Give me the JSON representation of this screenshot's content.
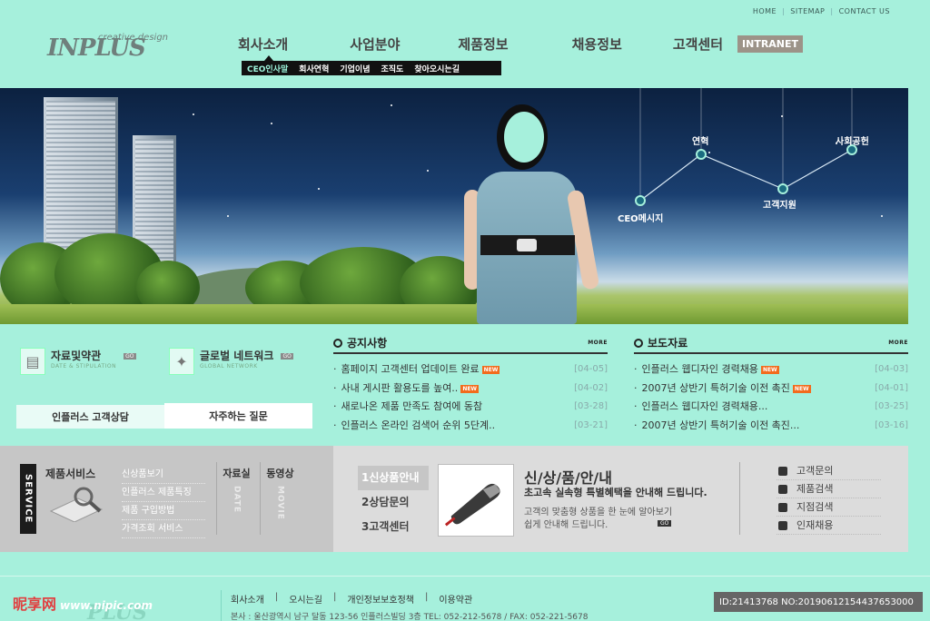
{
  "toplinks": [
    "HOME",
    "SITEMAP",
    "CONTACT US"
  ],
  "logo": {
    "brand": "INPLUS",
    "tagline": "creative design"
  },
  "nav": {
    "items": [
      "회사소개",
      "사업분야",
      "제품정보",
      "채용정보",
      "고객센터"
    ],
    "intranet": "INTRANET",
    "sub": [
      "CEO인사말",
      "회사연혁",
      "기업이념",
      "조직도",
      "찾아오시는길"
    ]
  },
  "banner": {
    "nodes": [
      "CEO메시지",
      "연혁",
      "고객지원",
      "사회공헌"
    ]
  },
  "quick": {
    "items": [
      {
        "title": "자료및약관",
        "sub": "DATE & STIPULATION",
        "icon": "document-icon"
      },
      {
        "title": "글로벌 네트워크",
        "sub": "GLOBAL NETWORK",
        "icon": "globe-icon"
      }
    ],
    "go": "GO",
    "consult_tabs": [
      "인플러스 고객상담",
      "자주하는 질문"
    ]
  },
  "notice": {
    "title": "공지사항",
    "more": "MORE",
    "items": [
      {
        "text": "홈페이지 고객센터 업데이트 완료",
        "new": true,
        "date": "[04-05]"
      },
      {
        "text": "사내 게시판 활용도를 높여..",
        "new": true,
        "date": "[04-02]"
      },
      {
        "text": "새로나온 제품 만족도 참여에 동참",
        "new": false,
        "date": "[03-28]"
      },
      {
        "text": "인플러스 온라인 검색어 순위 5단계..",
        "new": false,
        "date": "[03-21]"
      }
    ]
  },
  "press": {
    "title": "보도자료",
    "more": "MORE",
    "items": [
      {
        "text": "인플러스 웹디자인 경력채용",
        "new": true,
        "date": "[04-03]"
      },
      {
        "text": "2007년 상반기 특허기술 이전 촉진",
        "new": true,
        "date": "[04-01]"
      },
      {
        "text": "인플러스 웹디자인 경력채용...",
        "new": false,
        "date": "[03-25]"
      },
      {
        "text": "2007년 상반기 특허기술 이전 촉진...",
        "new": false,
        "date": "[03-16]"
      }
    ]
  },
  "new_label": "NEW",
  "service": {
    "tag": "SERVICE",
    "title": "제품서비스",
    "list": [
      "신상품보기",
      "인플러스 제품특징",
      "제품 구입방법",
      "가격조회 서비스"
    ],
    "col1": {
      "head": "자료실",
      "vertical": "DATE"
    },
    "col2": {
      "head": "동영상",
      "vertical": "MOVIE"
    },
    "tabs": [
      "1신상품안내",
      "2상담문의",
      "3고객센터"
    ],
    "product_title": "신/상/품/안/내",
    "product_sub": "초고속 실속형 특별혜택을 안내해 드립니다.",
    "product_desc": "고객의 맞춤형 상품을 한 눈에 알아보기 쉽게 안내해 드립니다.",
    "product_go": "GO",
    "links": [
      "고객문의",
      "제품검색",
      "지점검색",
      "인재채용"
    ]
  },
  "footer": {
    "nav": [
      "회사소개",
      "오시는길",
      "개인정보보호정책",
      "이용약관"
    ],
    "address": "본사 : 울산광역시 남구 달동 123-56 인플러스빌딩 3층  TEL: 052-212-5678 / FAX: 052-221-5678",
    "logo": "PLUS",
    "watermark_left": "昵享网",
    "watermark_left_url": "www.nipic.com",
    "watermark_right": "ID:21413768 NO:20190612154437653000"
  }
}
